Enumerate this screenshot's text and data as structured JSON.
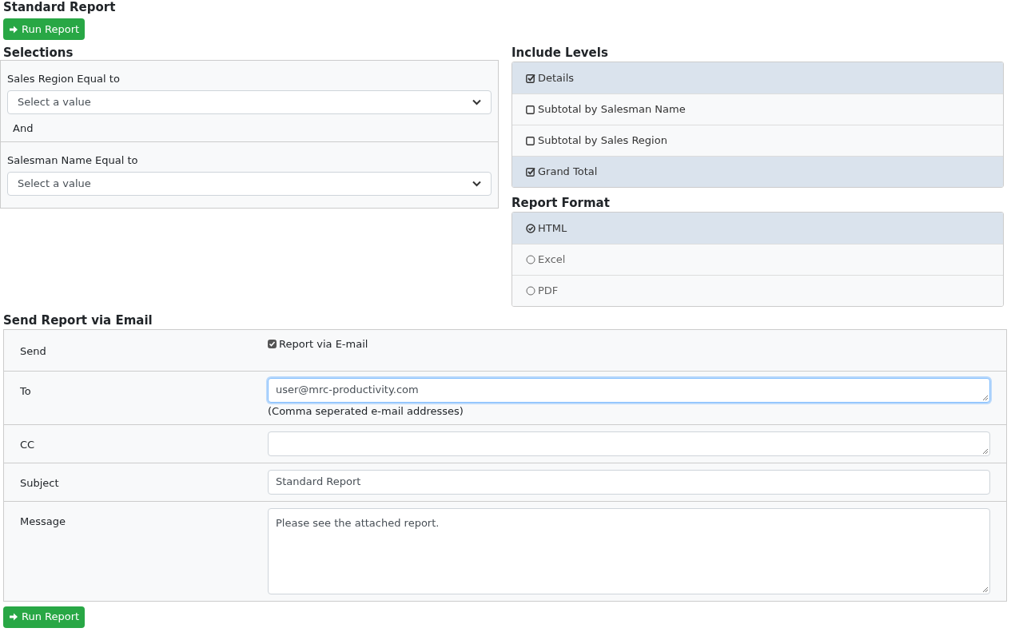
{
  "title": "Standard Report",
  "run_button_top": {
    "label": "Run Report"
  },
  "selections": {
    "title": "Selections",
    "filters": [
      {
        "label": "Sales Region Equal to",
        "placeholder": "Select a value",
        "connector": "And"
      },
      {
        "label": "Salesman Name Equal to",
        "placeholder": "Select a value"
      }
    ]
  },
  "include_levels": {
    "title": "Include Levels",
    "items": [
      {
        "label": "Details",
        "checked": true
      },
      {
        "label": "Subtotal by Salesman Name",
        "checked": false
      },
      {
        "label": "Subtotal by Sales Region",
        "checked": false
      },
      {
        "label": "Grand Total",
        "checked": true
      }
    ]
  },
  "report_format": {
    "title": "Report Format",
    "options": [
      {
        "label": "HTML",
        "selected": true
      },
      {
        "label": "Excel",
        "selected": false
      },
      {
        "label": "PDF",
        "selected": false
      }
    ]
  },
  "email": {
    "title": "Send Report via Email",
    "rows": [
      {
        "label": "Send",
        "kind": "checkbox",
        "text": "Report via E-mail",
        "checked": true
      },
      {
        "label": "To",
        "kind": "textarea",
        "value": "user@mrc-productivity.com",
        "focused": true,
        "hint": "(Comma seperated e-mail addresses)"
      },
      {
        "label": "CC",
        "kind": "textarea",
        "value": ""
      },
      {
        "label": "Subject",
        "kind": "input",
        "value": "Standard Report"
      },
      {
        "label": "Message",
        "kind": "message",
        "value": "Please see the attached report."
      }
    ]
  },
  "run_button_bottom": {
    "label": "Run Report"
  }
}
